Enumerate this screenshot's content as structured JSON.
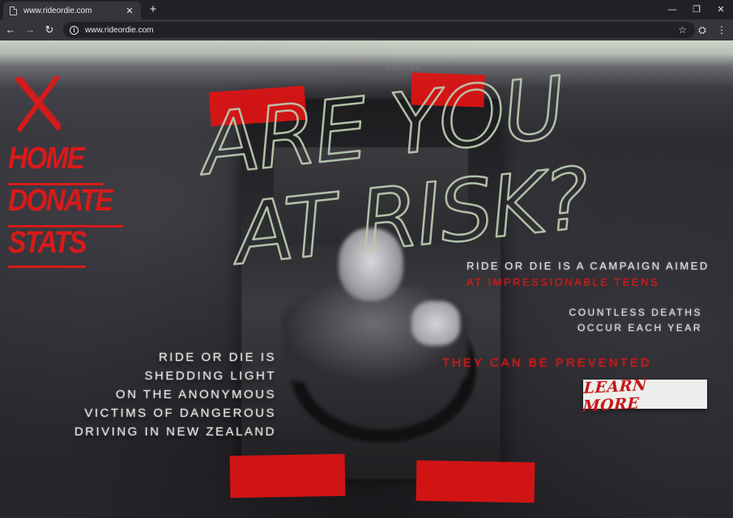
{
  "browser": {
    "tab_title": "www.rideordie.com",
    "tab_close": "✕",
    "new_tab": "+",
    "url": "www.rideordie.com",
    "back": "←",
    "forward": "→",
    "reload": "↻",
    "info": "i",
    "star": "☆",
    "window_controls": {
      "minimize": "—",
      "restore": "❐",
      "close": "✕"
    }
  },
  "site": {
    "headline": [
      "ARE YOU",
      "AT RISK?"
    ],
    "logo_mark": "X",
    "nav": [
      {
        "label": "HOME"
      },
      {
        "label": "DONATE"
      },
      {
        "label": "STATS"
      }
    ],
    "blurb_lines": [
      "RIDE OR DIE IS",
      "SHEDDING LIGHT",
      "ON THE ANONYMOUS",
      "VICTIMS OF DANGEROUS",
      "DRIVING IN NEW ZEALAND"
    ],
    "campaign_line1": "RIDE OR DIE IS A CAMPAIGN AIMED",
    "campaign_line2": "AT IMPRESSIONABLE TEENS",
    "countless_lines": [
      "COUNTLESS DEATHS",
      "OCCUR EACH YEAR"
    ],
    "prevented": "THEY CAN BE PREVENTED",
    "cta": "LEARN MORE",
    "photo_mark": "CHEEBA"
  },
  "colors": {
    "accent_red": "#d81a1a",
    "chalk": "#b9c8ad",
    "cta_bg": "#ecefeb"
  },
  "icons": [
    "page-icon",
    "close-icon",
    "plus-icon",
    "back-arrow-icon",
    "forward-arrow-icon",
    "reload-icon",
    "info-icon",
    "star-icon",
    "extension-icon",
    "menu-icon",
    "x-logo-icon"
  ]
}
